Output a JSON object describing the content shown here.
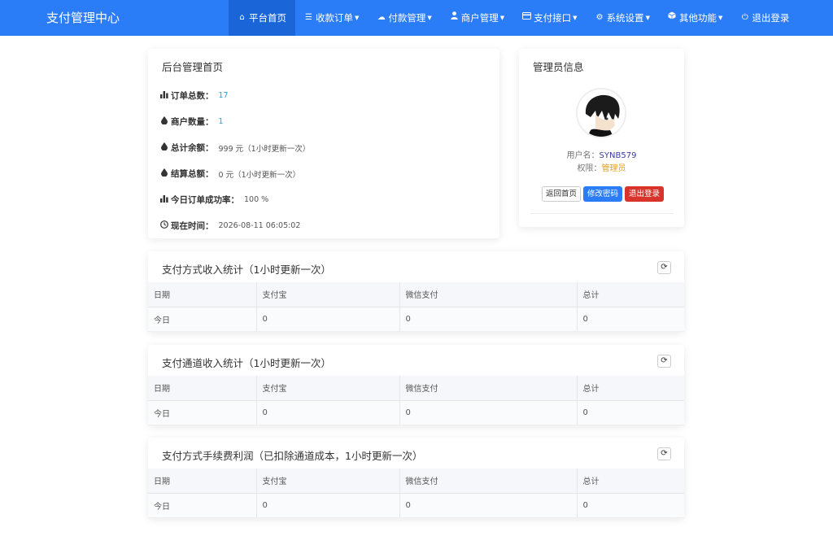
{
  "brand": "支付管理中心",
  "nav": [
    {
      "label": "平台首页",
      "icon": "home-icon",
      "caret": false
    },
    {
      "label": "收款订单",
      "icon": "list-icon",
      "caret": true
    },
    {
      "label": "付款管理",
      "icon": "cloud-icon",
      "caret": true
    },
    {
      "label": "商户管理",
      "icon": "user-icon",
      "caret": true
    },
    {
      "label": "支付接口",
      "icon": "card-icon",
      "caret": true
    },
    {
      "label": "系统设置",
      "icon": "gear-icon",
      "caret": true
    },
    {
      "label": "其他功能",
      "icon": "cube-icon",
      "caret": true
    },
    {
      "label": "退出登录",
      "icon": "power-icon",
      "caret": false
    }
  ],
  "home": {
    "title": "后台管理首页",
    "stats": [
      {
        "icon": "bar-chart-icon",
        "label": "订单总数：",
        "value": "17"
      },
      {
        "icon": "drop-icon",
        "label": "商户数量：",
        "value": "1"
      },
      {
        "icon": "drop-icon",
        "label": "总计余额：",
        "value": "999 元（1小时更新一次）"
      },
      {
        "icon": "drop-icon",
        "label": "结算总额：",
        "value": "0 元（1小时更新一次）"
      },
      {
        "icon": "bar-chart-icon",
        "label": "今日订单成功率：",
        "value": "100 %"
      },
      {
        "icon": "clock-icon",
        "label": "现在时间：",
        "value": "2026-08-11 06:05:02"
      }
    ]
  },
  "admin": {
    "title": "管理员信息",
    "username_label": "用户名：",
    "username": "SYNB579",
    "role_label": "权限：",
    "role": "管理员",
    "btn_home": "返回首页",
    "btn_password": "修改密码",
    "btn_logout": "退出登录"
  },
  "tables": [
    {
      "title": "支付方式收入统计（1小时更新一次）",
      "headers": [
        "日期",
        "支付宝",
        "微信支付",
        "总计"
      ],
      "row": [
        "今日",
        "0",
        "0",
        "0"
      ]
    },
    {
      "title": "支付通道收入统计（1小时更新一次）",
      "headers": [
        "日期",
        "支付宝",
        "微信支付",
        "总计"
      ],
      "row": [
        "今日",
        "0",
        "0",
        "0"
      ]
    },
    {
      "title": "支付方式手续费利润（已扣除通道成本，1小时更新一次）",
      "headers": [
        "日期",
        "支付宝",
        "微信支付",
        "总计"
      ],
      "row": [
        "今日",
        "0",
        "0",
        "0"
      ]
    }
  ],
  "colors": {
    "navbar": "#2a7cf7",
    "active_nav": "#1a66d9",
    "link_blue": "#2a9fd6",
    "role_gold": "#e0a020",
    "danger": "#d9342b"
  }
}
